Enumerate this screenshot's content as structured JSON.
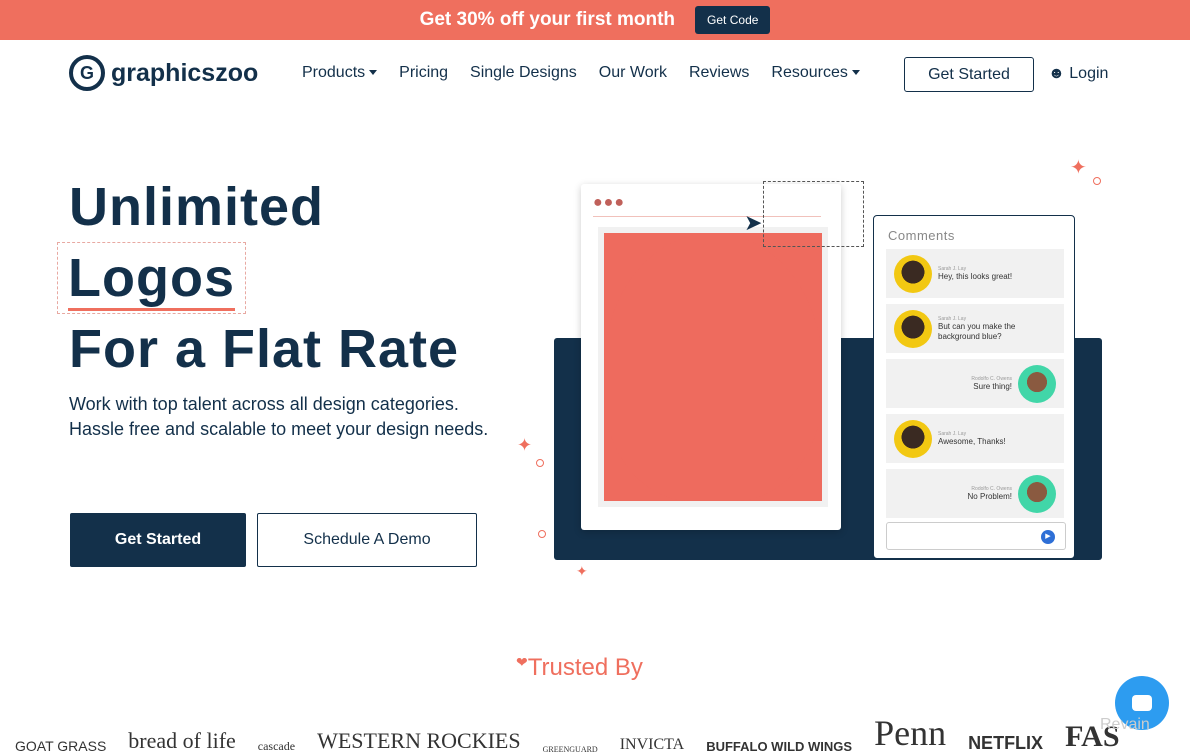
{
  "promo": {
    "text": "Get 30% off your first month",
    "button": "Get Code"
  },
  "header": {
    "logo": "graphicszoo",
    "menu": [
      {
        "label": "Products",
        "dropdown": true
      },
      {
        "label": "Pricing"
      },
      {
        "label": "Single Designs"
      },
      {
        "label": "Our Work"
      },
      {
        "label": "Reviews"
      },
      {
        "label": "Resources",
        "dropdown": true
      }
    ],
    "get_started": "Get Started",
    "login": "Login"
  },
  "hero": {
    "line1": "Unlimited",
    "line2": "Logos",
    "line3": "For a Flat Rate",
    "subtitle": "Work with top talent across all design categories. Hassle free and scalable to meet your design needs.",
    "primary_button": "Get Started",
    "secondary_button": "Schedule A Demo"
  },
  "comments": {
    "title": "Comments",
    "items": [
      {
        "author": "Sarah J. Lay",
        "text": "Hey, this looks great!",
        "side": "left"
      },
      {
        "author": "Sarah J. Lay",
        "text": "But can you make the background blue?",
        "side": "left"
      },
      {
        "author": "Rodolfo C. Owens",
        "text": "Sure thing!",
        "side": "right"
      },
      {
        "author": "Sarah J. Lay",
        "text": "Awesome, Thanks!",
        "side": "left"
      },
      {
        "author": "Rodolfo C. Owens",
        "text": "No Problem!",
        "side": "right"
      }
    ]
  },
  "trusted": {
    "title": "Trusted By",
    "brands": [
      "GOAT GRASS",
      "bread of life",
      "cascade",
      "WESTERN ROCKIES",
      "GREENGUARD",
      "INVICTA",
      "BUFFALO WILD WINGS",
      "Penn",
      "NETFLIX",
      "FAS"
    ]
  },
  "watermark": "Revain",
  "colors": {
    "accent": "#ef6f5e",
    "navy": "#13304a",
    "chat": "#2d9cf0"
  }
}
